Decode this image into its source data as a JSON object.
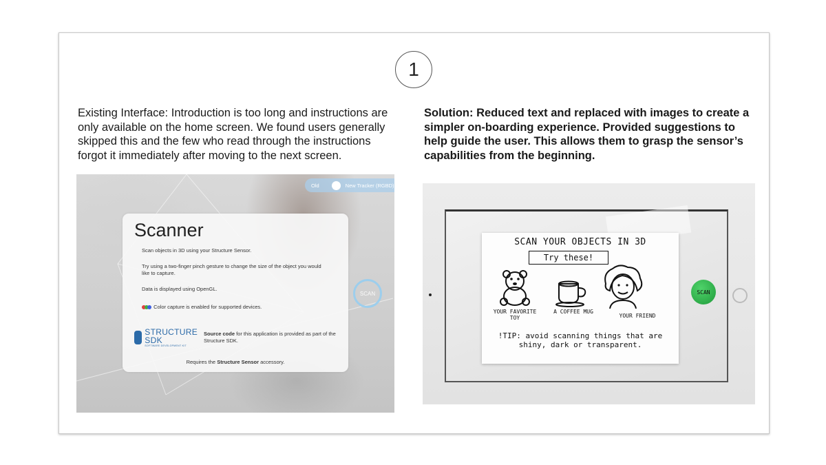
{
  "step_number": "1",
  "existing": {
    "caption": "Existing Interface: Introduction is too long and instructions are only available on the home screen. We found users generally skipped this and the few who read through the instructions forgot it immediately after moving to the next screen.",
    "toggle_old": "Old",
    "toggle_new": "New Tracker (RGBD)",
    "scan_label": "SCAN",
    "card_title": "Scanner",
    "line1": "Scan objects in 3D using your Structure Sensor.",
    "line2": "Try using a two-finger pinch gesture to change the size of the object you would like to capture.",
    "line3": "Data is displayed using OpenGL.",
    "line4": "Color capture is enabled for supported devices.",
    "sdk_logo_big": "STRUCTURE SDK",
    "sdk_logo_small": "SOFTWARE DEVELOPMENT KIT",
    "source_bold": "Source code",
    "source_rest": " for this application is provided as part of the Structure SDK.",
    "require_prefix": "Requires the ",
    "require_bold": "Structure Sensor",
    "require_suffix": " accessory.",
    "dot_colors": [
      "#e04040",
      "#40b040",
      "#4060e0"
    ]
  },
  "solution": {
    "caption": "Solution: Reduced text and replaced with images to create a simpler on-boarding experience. Provided suggestions to help guide the user. This allows them to grasp the sensor’s capabilities from the beginning.",
    "sketch_title": "SCAN YOUR OBJECTS IN 3D",
    "try_label": "Try these!",
    "item1": "YOUR FAVORITE TOY",
    "item2": "A COFFEE MUG",
    "item3": "YOUR FRIEND",
    "tip": "!TIP: avoid scanning things that are shiny, dark or transparent.",
    "scan_button": "SCAN"
  }
}
